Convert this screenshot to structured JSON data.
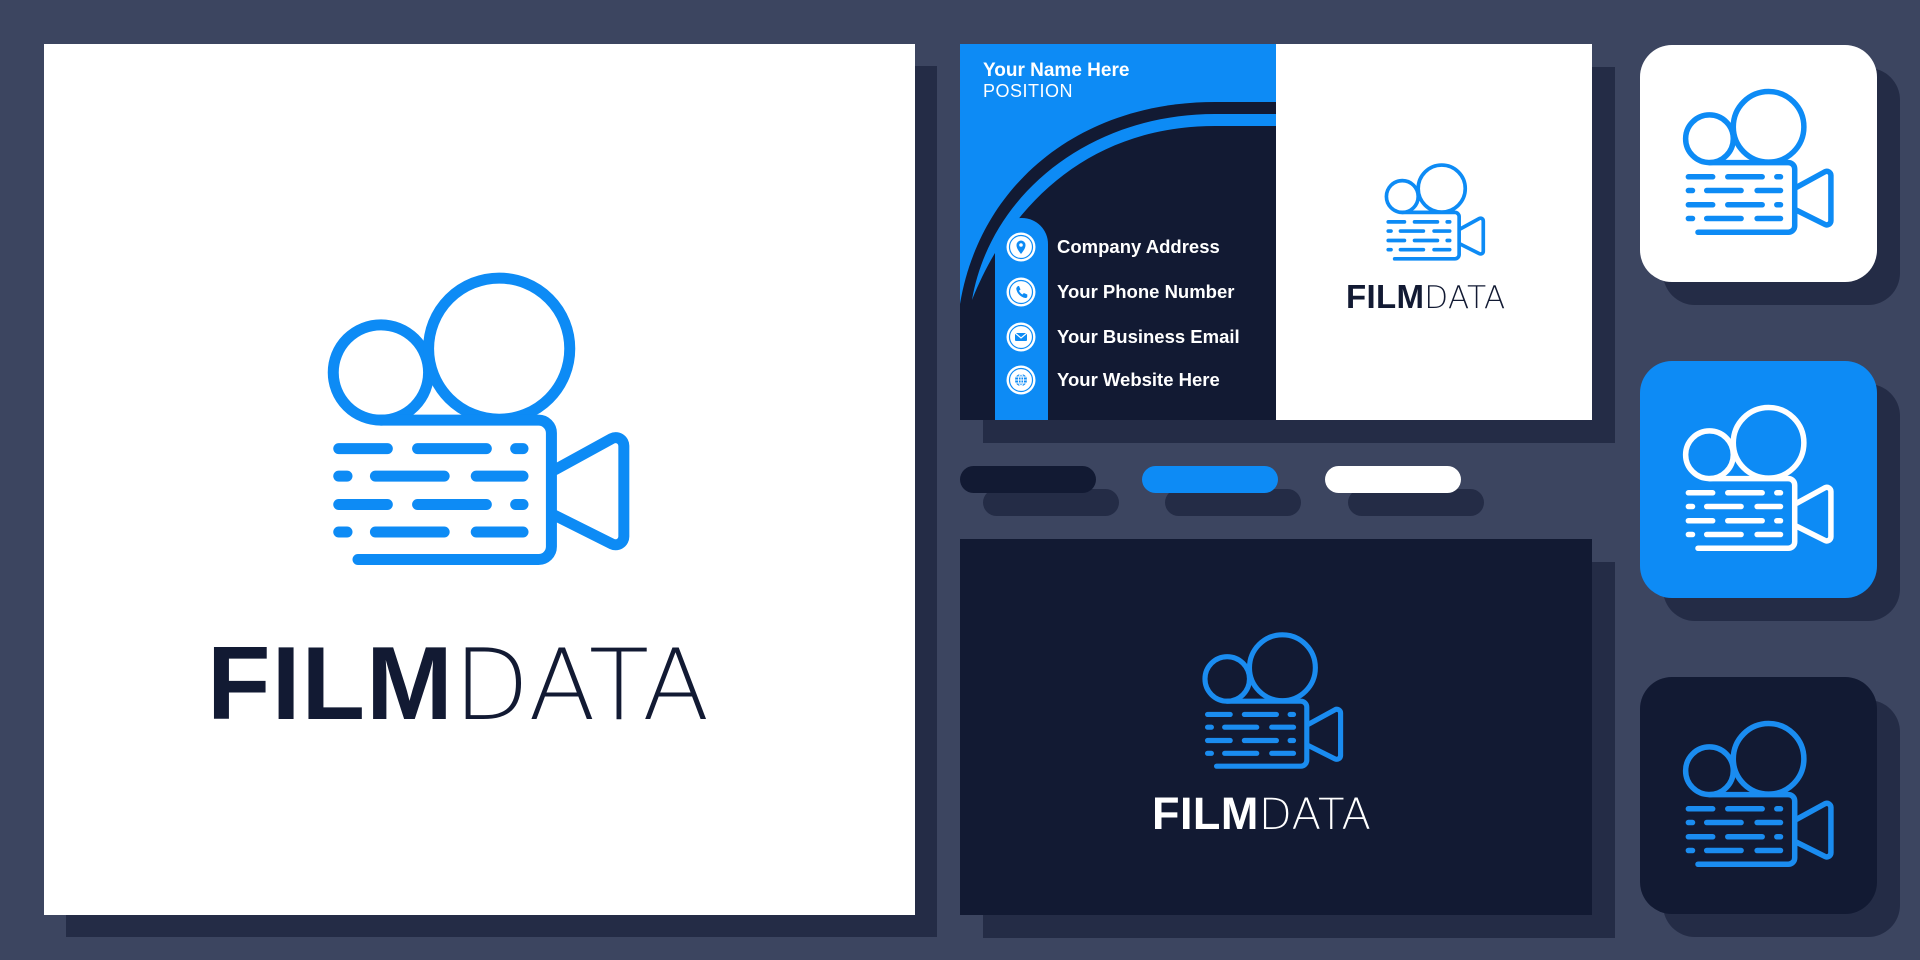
{
  "brand": {
    "name_bold": "FILM",
    "name_light": "DATA",
    "colors": {
      "background": "#3c4560",
      "shadow": "#242c46",
      "navy": "#121a33",
      "blue": "#0d8bf5",
      "white": "#ffffff"
    }
  },
  "logo_icon": "film-camera-data-icon",
  "business_card": {
    "front": {
      "name": "Your Name Here",
      "position": "POSITION",
      "contacts": [
        {
          "icon": "location-pin-icon",
          "label": "Company Address"
        },
        {
          "icon": "phone-icon",
          "label": "Your Phone Number"
        },
        {
          "icon": "email-icon",
          "label": "Your Business Email"
        },
        {
          "icon": "globe-icon",
          "label": "Your Website Here"
        }
      ]
    }
  },
  "swatches": [
    {
      "name": "navy",
      "color": "#121a33"
    },
    {
      "name": "blue",
      "color": "#0d8bf5"
    },
    {
      "name": "white",
      "color": "#ffffff"
    }
  ],
  "app_icons": [
    {
      "variant": "white",
      "background": "#ffffff",
      "stroke": "#0d8bf5"
    },
    {
      "variant": "blue",
      "background": "#0d8bf5",
      "stroke": "#ffffff"
    },
    {
      "variant": "dark",
      "background": "#121a33",
      "stroke": "#1a8cf0"
    }
  ]
}
